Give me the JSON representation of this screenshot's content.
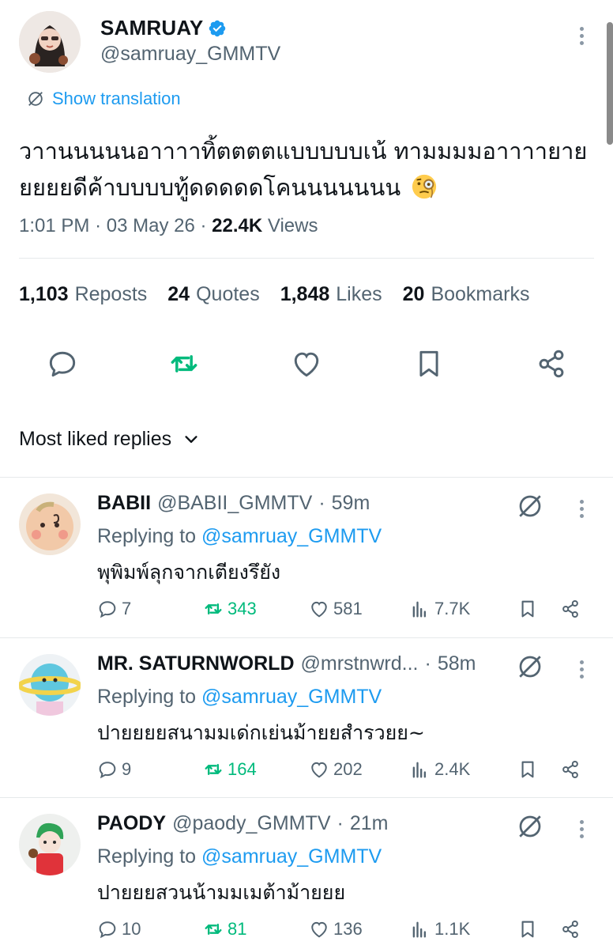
{
  "post": {
    "author_name": "SAMRUAY",
    "author_handle": "@samruay_GMMTV",
    "translate_label": "Show translation",
    "text_line1": "วาานนนนนอาาาาทิ้ตตตตแบบบบบเน้ ทามมมมอาาาายาย",
    "text_line2": "ยยยยดีค้าบบบบทู้ดดดดดโคนนนนนนน",
    "emoji": "face-with-monocle",
    "time": "1:01 PM",
    "date": "03 May 26",
    "views_count": "22.4K",
    "views_label": "Views"
  },
  "stats": {
    "reposts_count": "1,103",
    "reposts_label": "Reposts",
    "quotes_count": "24",
    "quotes_label": "Quotes",
    "likes_count": "1,848",
    "likes_label": "Likes",
    "bookmarks_count": "20",
    "bookmarks_label": "Bookmarks"
  },
  "actions": [
    "reply-icon",
    "repost-icon",
    "like-icon",
    "bookmark-icon",
    "share-icon"
  ],
  "sort": {
    "label": "Most liked replies"
  },
  "replies": [
    {
      "name": "BABII",
      "handle": "@BABII_GMMTV",
      "time": "59m",
      "replying_prefix": "Replying to",
      "replying_to": "@samruay_GMMTV",
      "text": "พุพิมพ์ลุกจากเตียงรึยัง",
      "replies": "7",
      "reposts": "343",
      "likes": "581",
      "views": "7.7K"
    },
    {
      "name": "MR. SATURNWORLD",
      "handle": "@mrstnwrd...",
      "time": "58m",
      "replying_prefix": "Replying to",
      "replying_to": "@samruay_GMMTV",
      "text": "ปายยยยสนามมเด่กเย่นม้ายยสำรวยย~",
      "replies": "9",
      "reposts": "164",
      "likes": "202",
      "views": "2.4K"
    },
    {
      "name": "PAODY",
      "handle": "@paody_GMMTV",
      "time": "21m",
      "replying_prefix": "Replying to",
      "replying_to": "@samruay_GMMTV",
      "text": "ปายยยสวนน้ามมเมต้าม้ายยย",
      "replies": "10",
      "reposts": "81",
      "likes": "136",
      "views": "1.1K"
    }
  ],
  "colors": {
    "accent": "#1d9bf0",
    "repost_green": "#00ba7c",
    "muted": "#536471",
    "text": "#0f1419"
  }
}
